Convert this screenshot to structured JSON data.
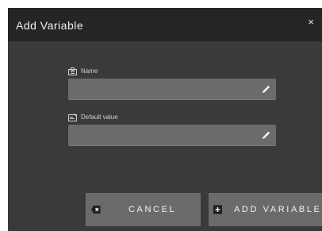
{
  "dialog": {
    "title": "Add Variable",
    "close_glyph": "×"
  },
  "fields": [
    {
      "label": "Name",
      "icon": "name-tag-icon",
      "value": "",
      "placeholder": ""
    },
    {
      "label": "Default value",
      "icon": "default-value-icon",
      "value": "",
      "placeholder": ""
    }
  ],
  "buttons": {
    "cancel": {
      "label": "CANCEL",
      "icon": "backspace-icon"
    },
    "add": {
      "label": "ADD VARIABLE",
      "icon": "plus-box-icon"
    }
  },
  "colors": {
    "dialog_bg": "#3a3a3a",
    "titlebar_bg": "#252525",
    "field_bg": "#6b6b6b",
    "button_bg": "#6b6b6b",
    "text": "#f0f0f0"
  }
}
